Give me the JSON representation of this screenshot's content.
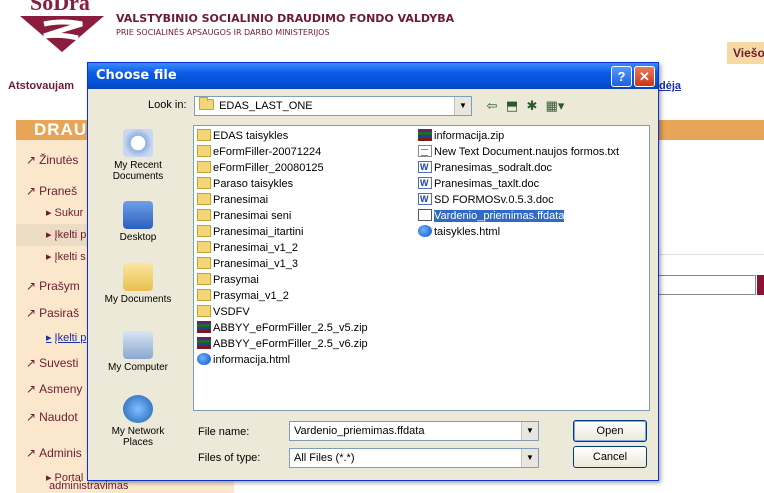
{
  "page": {
    "logo_text": "SoDra",
    "header_title": "VALSTYBINIO SOCIALINIO DRAUDIMO FONDO VALDYBA",
    "header_subtitle": "PRIE SOCIALINĖS APSAUGOS IR DARBO MINISTERIJOS",
    "viesoji": "Viešoj",
    "atstovaujam": "Atstovaujam",
    "right_link": "dėja",
    "band_title": "DRAU",
    "sidebar": [
      {
        "label": "Žinutės",
        "arrow": "↗",
        "sub": false
      },
      {
        "label": "Praneš",
        "arrow": "↗",
        "sub": false
      },
      {
        "label": "Sukur",
        "arrow": "▸",
        "sub": true
      },
      {
        "label": "Įkelti p",
        "arrow": "▸",
        "sub": true,
        "highlight": true
      },
      {
        "label": "Įkelti s",
        "arrow": "▸",
        "sub": true
      },
      {
        "label": "Prašym",
        "arrow": "↗",
        "sub": false
      },
      {
        "label": "Pasiraš",
        "arrow": "↗",
        "sub": false
      },
      {
        "label": "Įkelti p",
        "arrow": "▸",
        "sub": true
      },
      {
        "label": "Suvesti",
        "arrow": "↗",
        "sub": false
      },
      {
        "label": "Asmeny",
        "arrow": "↗",
        "sub": false
      },
      {
        "label": "Naudot",
        "arrow": "↗",
        "sub": false
      },
      {
        "label": "Adminis",
        "arrow": "↗",
        "sub": false
      },
      {
        "label": "Portal",
        "arrow": "▸",
        "sub": true
      },
      {
        "label": "administravimas",
        "arrow": "",
        "sub": true
      }
    ]
  },
  "dialog": {
    "title": "Choose file",
    "help_icon_label": "?",
    "close_icon_label": "✕",
    "look_in_label": "Look in:",
    "look_in_value": "EDAS_LAST_ONE",
    "places": [
      {
        "label": "My Recent\nDocuments",
        "icon": "recent-documents-icon"
      },
      {
        "label": "Desktop",
        "icon": "desktop-icon"
      },
      {
        "label": "My Documents",
        "icon": "my-documents-icon"
      },
      {
        "label": "My Computer",
        "icon": "my-computer-icon"
      },
      {
        "label": "My Network\nPlaces",
        "icon": "network-places-icon"
      }
    ],
    "files_col1": [
      {
        "name": "EDAS taisykles",
        "type": "folder"
      },
      {
        "name": "eFormFiller-20071224",
        "type": "folder"
      },
      {
        "name": "eFormFiller_20080125",
        "type": "folder"
      },
      {
        "name": "Paraso taisykles",
        "type": "folder"
      },
      {
        "name": "Pranesimai",
        "type": "folder"
      },
      {
        "name": "Pranesimai seni",
        "type": "folder"
      },
      {
        "name": "Pranesimai_itartini",
        "type": "folder"
      },
      {
        "name": "Pranesimai_v1_2",
        "type": "folder"
      },
      {
        "name": "Pranesimai_v1_3",
        "type": "folder"
      },
      {
        "name": "Prasymai",
        "type": "folder"
      },
      {
        "name": "Prasymai_v1_2",
        "type": "folder"
      },
      {
        "name": "VSDFV",
        "type": "folder"
      },
      {
        "name": "ABBYY_eFormFiller_2.5_v5.zip",
        "type": "zip"
      },
      {
        "name": "ABBYY_eFormFiller_2.5_v6.zip",
        "type": "zip"
      },
      {
        "name": "informacija.html",
        "type": "html"
      }
    ],
    "files_col2": [
      {
        "name": "informacija.zip",
        "type": "zip"
      },
      {
        "name": "New Text Document.naujos formos.txt",
        "type": "txt"
      },
      {
        "name": "Pranesimas_sodralt.doc",
        "type": "doc"
      },
      {
        "name": "Pranesimas_taxlt.doc",
        "type": "doc"
      },
      {
        "name": "SD FORMOSv.0.5.3.doc",
        "type": "doc"
      },
      {
        "name": "Vardenio_priemimas.ffdata",
        "type": "ff",
        "selected": true
      },
      {
        "name": "taisykles.html",
        "type": "html"
      }
    ],
    "file_name_label": "File name:",
    "file_name_value": "Vardenio_priemimas.ffdata",
    "files_of_type_label": "Files of type:",
    "files_of_type_value": "All Files (*.*)",
    "open_label": "Open",
    "cancel_label": "Cancel"
  }
}
